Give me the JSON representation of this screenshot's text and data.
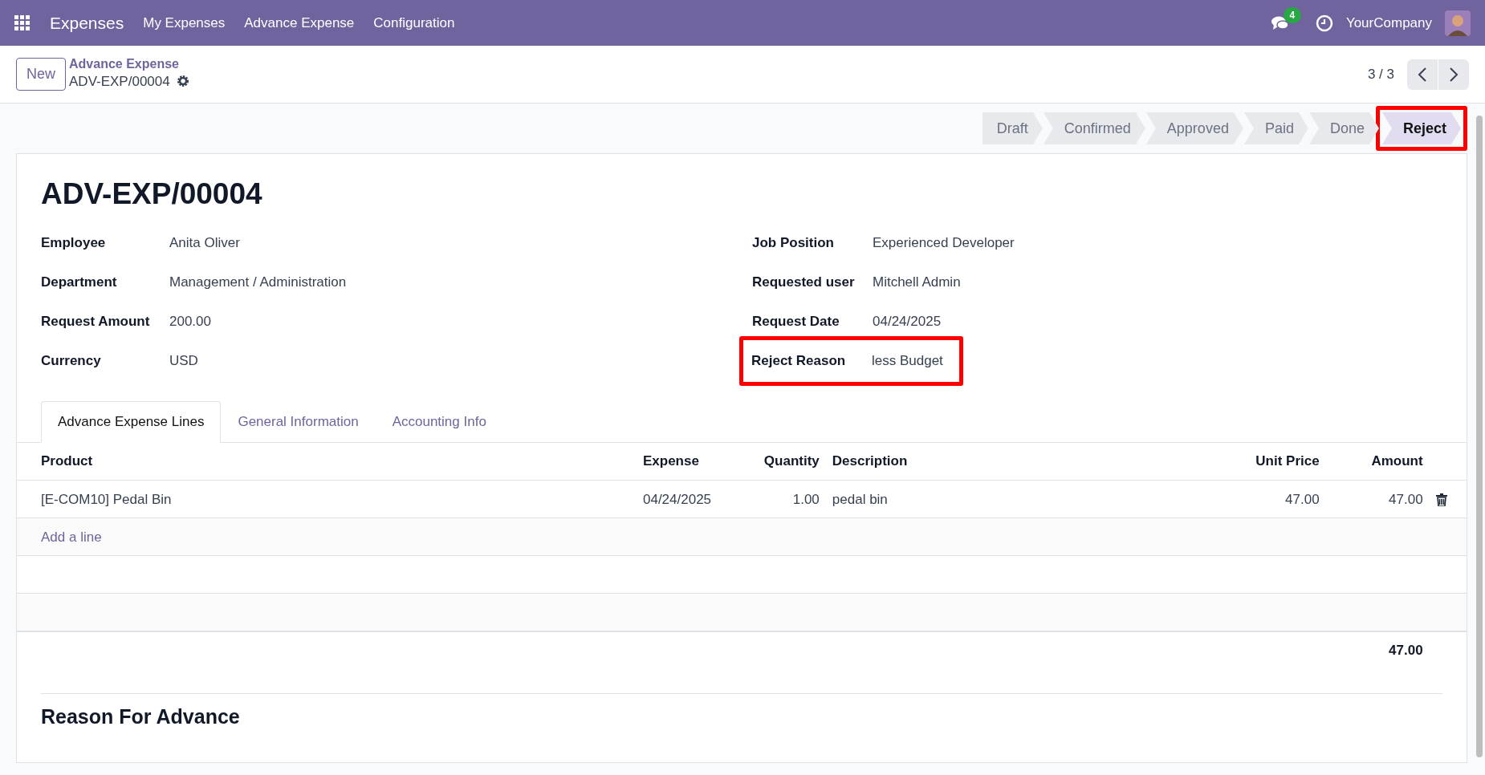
{
  "navbar": {
    "app_name": "Expenses",
    "menu": [
      "My Expenses",
      "Advance Expense",
      "Configuration"
    ],
    "message_count": "4",
    "company": "YourCompany"
  },
  "control_panel": {
    "new_button": "New",
    "breadcrumb": "Advance Expense",
    "record_name": "ADV-EXP/00004",
    "pager": "3 / 3"
  },
  "status_steps": [
    {
      "label": "Draft",
      "selected": false,
      "highlighted": false
    },
    {
      "label": "Confirmed",
      "selected": false,
      "highlighted": false
    },
    {
      "label": "Approved",
      "selected": false,
      "highlighted": false
    },
    {
      "label": "Paid",
      "selected": false,
      "highlighted": false
    },
    {
      "label": "Done",
      "selected": false,
      "highlighted": false
    },
    {
      "label": "Reject",
      "selected": true,
      "highlighted": true
    }
  ],
  "form": {
    "title": "ADV-EXP/00004",
    "left_fields": [
      {
        "label": "Employee",
        "value": "Anita Oliver",
        "highlighted": false
      },
      {
        "label": "Department",
        "value": "Management / Administration",
        "highlighted": false
      },
      {
        "label": "Request Amount",
        "value": "200.00",
        "highlighted": false
      },
      {
        "label": "Currency",
        "value": "USD",
        "highlighted": false
      }
    ],
    "right_fields": [
      {
        "label": "Job Position",
        "value": "Experienced Developer",
        "highlighted": false
      },
      {
        "label": "Requested user",
        "value": "Mitchell Admin",
        "highlighted": false
      },
      {
        "label": "Request Date",
        "value": "04/24/2025",
        "highlighted": false
      },
      {
        "label": "Reject Reason",
        "value": "less Budget",
        "highlighted": true
      }
    ]
  },
  "tabs": [
    {
      "label": "Advance Expense Lines",
      "selected": true
    },
    {
      "label": "General Information",
      "selected": false
    },
    {
      "label": "Accounting Info",
      "selected": false
    }
  ],
  "lines": {
    "columns": [
      "Product",
      "Expense",
      "Quantity",
      "Description",
      "Unit Price",
      "Amount"
    ],
    "rows": [
      {
        "cells": [
          "[E-COM10] Pedal Bin",
          "04/24/2025",
          "1.00",
          "pedal bin",
          "47.00",
          "47.00"
        ]
      }
    ],
    "add_line": "Add a line",
    "total": "47.00"
  },
  "reason_heading": "Reason For Advance"
}
